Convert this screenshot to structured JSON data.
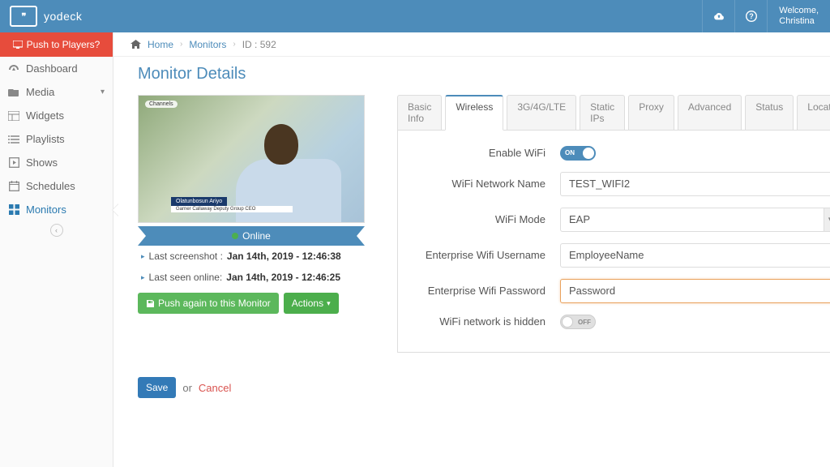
{
  "brand": {
    "name": "yodeck",
    "logo_glyph": "❞"
  },
  "topbar": {
    "welcome_label": "Welcome,",
    "username": "Christina"
  },
  "sidebar": {
    "push_label": "Push to Players?",
    "items": [
      {
        "label": "Dashboard",
        "icon": "gauge"
      },
      {
        "label": "Media",
        "icon": "folder",
        "expandable": true
      },
      {
        "label": "Widgets",
        "icon": "widgets"
      },
      {
        "label": "Playlists",
        "icon": "list"
      },
      {
        "label": "Shows",
        "icon": "play"
      },
      {
        "label": "Schedules",
        "icon": "calendar"
      },
      {
        "label": "Monitors",
        "icon": "grid",
        "active": true
      }
    ]
  },
  "breadcrumb": {
    "home": "Home",
    "monitors": "Monitors",
    "current": "ID : 592"
  },
  "page_title": "Monitor Details",
  "monitor": {
    "status_label": "Online",
    "lower_third_name": "Olatunbosun Ariyo",
    "lower_third_sub": "Garner Callaway Deputy Group CEO",
    "watermark": "Channels",
    "last_screenshot_label": "Last screenshot :",
    "last_screenshot_value": "Jan 14th, 2019 - 12:46:38",
    "last_seen_label": "Last seen online:",
    "last_seen_value": "Jan 14th, 2019 - 12:46:25",
    "push_btn": "Push again to this Monitor",
    "actions_btn": "Actions"
  },
  "tabs": [
    "Basic Info",
    "Wireless",
    "3G/4G/LTE",
    "Static IPs",
    "Proxy",
    "Advanced",
    "Status",
    "Location"
  ],
  "active_tab": "Wireless",
  "form": {
    "enable_wifi_label": "Enable WiFi",
    "enable_wifi_on": "ON",
    "network_name_label": "WiFi Network Name",
    "network_name_value": "TEST_WIFI2",
    "wifi_mode_label": "WiFi Mode",
    "wifi_mode_value": "EAP",
    "ent_user_label": "Enterprise Wifi Username",
    "ent_user_value": "EmployeeName",
    "ent_pass_label": "Enterprise Wifi Password",
    "ent_pass_value": "Password",
    "hidden_label": "WiFi network is hidden",
    "hidden_off": "OFF"
  },
  "footer": {
    "save": "Save",
    "or": "or",
    "cancel": "Cancel"
  }
}
